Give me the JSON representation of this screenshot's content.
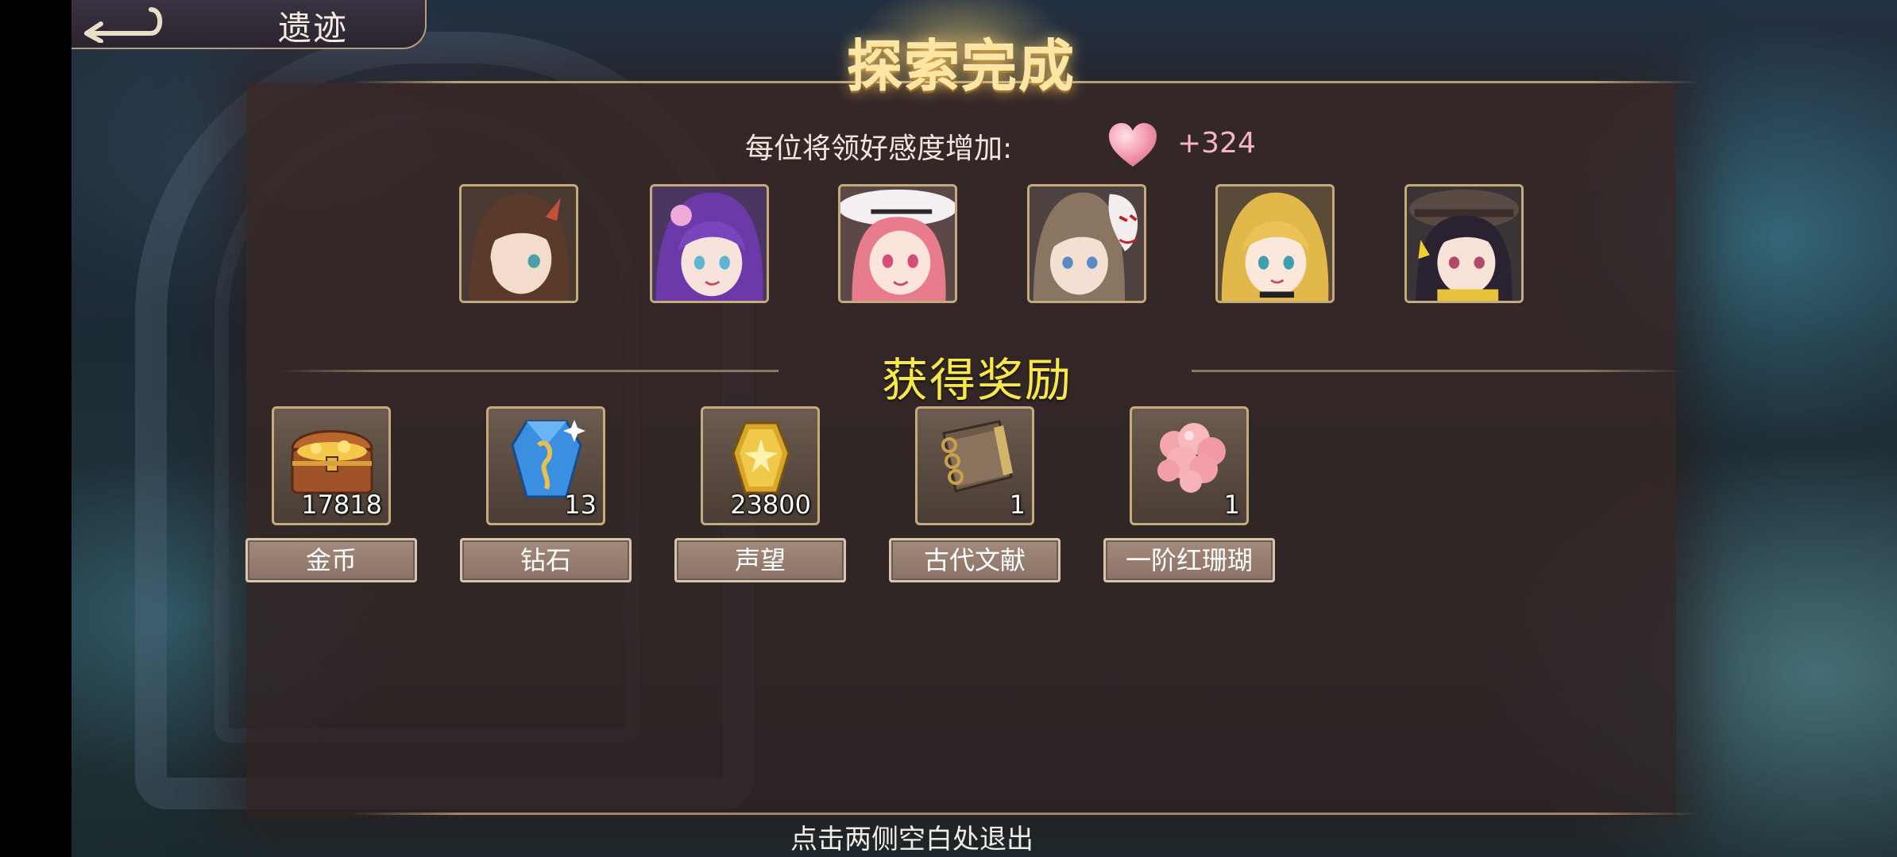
{
  "header": {
    "back_icon": "back-arrow-icon",
    "location": "遗迹"
  },
  "banner": {
    "title": "探索完成"
  },
  "affection": {
    "label": "每位将领好感度增加:",
    "icon": "heart-icon",
    "value": "+324"
  },
  "generals": [
    {
      "name": "general-portrait-1",
      "hair": "#5a3a2a"
    },
    {
      "name": "general-portrait-2",
      "hair": "#6b3aa8"
    },
    {
      "name": "general-portrait-3",
      "hair": "#e87b8c"
    },
    {
      "name": "general-portrait-4",
      "hair": "#8a7562"
    },
    {
      "name": "general-portrait-5",
      "hair": "#e3b84a"
    },
    {
      "name": "general-portrait-6",
      "hair": "#2a2230"
    }
  ],
  "rewards_section": {
    "title": "获得奖励",
    "items": [
      {
        "label": "金币",
        "count": "17818",
        "icon": "treasure-chest-icon"
      },
      {
        "label": "钻石",
        "count": "13",
        "icon": "diamond-crystal-icon"
      },
      {
        "label": "声望",
        "count": "23800",
        "icon": "prestige-medal-icon"
      },
      {
        "label": "古代文献",
        "count": "1",
        "icon": "ancient-book-icon"
      },
      {
        "label": "一阶红珊瑚",
        "count": "1",
        "icon": "red-coral-icon"
      }
    ]
  },
  "footer": {
    "exit_hint": "点击两侧空白处退出"
  },
  "colors": {
    "gold_border": "#c5ab7c",
    "reward_title": "#f8e84a",
    "affection_value": "#f5b6c2"
  }
}
